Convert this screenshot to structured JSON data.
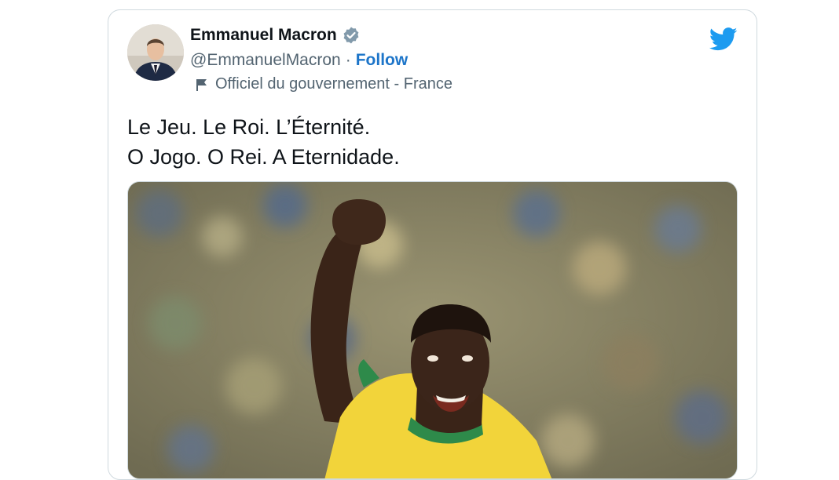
{
  "tweet": {
    "author": {
      "name": "Emmanuel Macron",
      "handle": "@EmmanuelMacron",
      "separator": "·",
      "follow_label": "Follow",
      "label": "Officiel du gouvernement - France",
      "verified": true
    },
    "text_lines": [
      "Le Jeu. Le Roi. L’Éternité.",
      "O Jogo. O Rei. A Eternidade."
    ],
    "media": {
      "type": "photo"
    },
    "brand_icon": "twitter-bird-icon"
  },
  "colors": {
    "twitter_blue": "#1d9bf0",
    "follow_blue": "#1d75c9",
    "text": "#0f1419",
    "secondary": "#536471",
    "border": "#cfd9de",
    "jersey_yellow": "#f2d43a",
    "jersey_green": "#2e8a4a"
  }
}
